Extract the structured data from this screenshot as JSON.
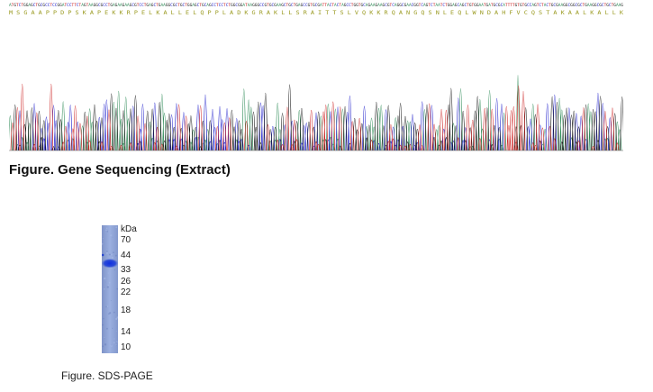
{
  "sequencing": {
    "nucleotide_sequence": "ATGTCTGGAGCTGCGCCTCCGGATCCTTCTAGTAAGGCGCCTGAGAAGAAGCGTCCTGAGCTGAAGGCGCTGCTGGAGCTGCAGCCTCCTCTGGCGGATAAGGGCCGTGCGAAGCTGCTGAGCCGTGCGATTACTACTAGCCTGGTGCAGAAGAAGCGTCAGGCGAACGGTCAGTCTAATCTGGAGCAGCTGTGGAATGATGCGCATTTTGTGTGCCAGTCTACTGCGAAGGCGGCGCTGAAGGCGCTGCTGAAG",
    "amino_acid_sequence": "M S G A A P P D P S K A P E K K R P E L K A L L E L Q P P L A D K G R A K L L S R A I T T S L V Q K K R Q A N G Q S N L E Q L W N D A H F V C Q S T A K A A L K A L L K",
    "colors": {
      "A": "#2e8b57",
      "C": "#2222cc",
      "G": "#111111",
      "T": "#cc2222",
      "aa_text": "#9a9a20"
    },
    "caption": "Figure. Gene Sequencing (Extract)"
  },
  "gel": {
    "unit": "kDa",
    "markers": [
      "70",
      "44",
      "33",
      "26",
      "22",
      "18",
      "14",
      "10"
    ],
    "band_kda": 38,
    "lane_color": "#8fa3d6",
    "band_color": "#1a3fd9",
    "caption": "Figure. SDS-PAGE"
  }
}
